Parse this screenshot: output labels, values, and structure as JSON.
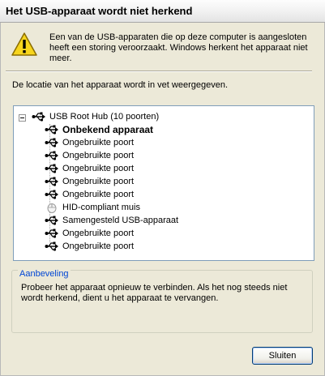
{
  "window": {
    "title": "Het USB-apparaat wordt niet herkend"
  },
  "header": {
    "message": "Een van de USB-apparaten die op deze computer is aangesloten heeft een storing veroorzaakt. Windows herkent het apparaat niet meer."
  },
  "location_text": "De locatie van het apparaat wordt in vet weergegeven.",
  "tree": {
    "root": {
      "label": "USB Root Hub (10 poorten)",
      "icon": "usb-icon"
    },
    "children": [
      {
        "label": "Onbekend apparaat",
        "icon": "usb-icon",
        "bold": true
      },
      {
        "label": "Ongebruikte poort",
        "icon": "usb-icon"
      },
      {
        "label": "Ongebruikte poort",
        "icon": "usb-icon"
      },
      {
        "label": "Ongebruikte poort",
        "icon": "usb-icon"
      },
      {
        "label": "Ongebruikte poort",
        "icon": "usb-icon"
      },
      {
        "label": "Ongebruikte poort",
        "icon": "usb-icon"
      },
      {
        "label": "HID-compliant muis",
        "icon": "mouse-icon"
      },
      {
        "label": "Samengesteld USB-apparaat",
        "icon": "usb-icon"
      },
      {
        "label": "Ongebruikte poort",
        "icon": "usb-icon"
      },
      {
        "label": "Ongebruikte poort",
        "icon": "usb-icon"
      }
    ]
  },
  "recommendation": {
    "title": "Aanbeveling",
    "text": "Probeer het apparaat opnieuw te verbinden. Als het nog steeds niet wordt herkend, dient u het apparaat te vervangen."
  },
  "buttons": {
    "close": "Sluiten"
  },
  "colors": {
    "group_title": "#0046d5",
    "background": "#ece9d8"
  }
}
